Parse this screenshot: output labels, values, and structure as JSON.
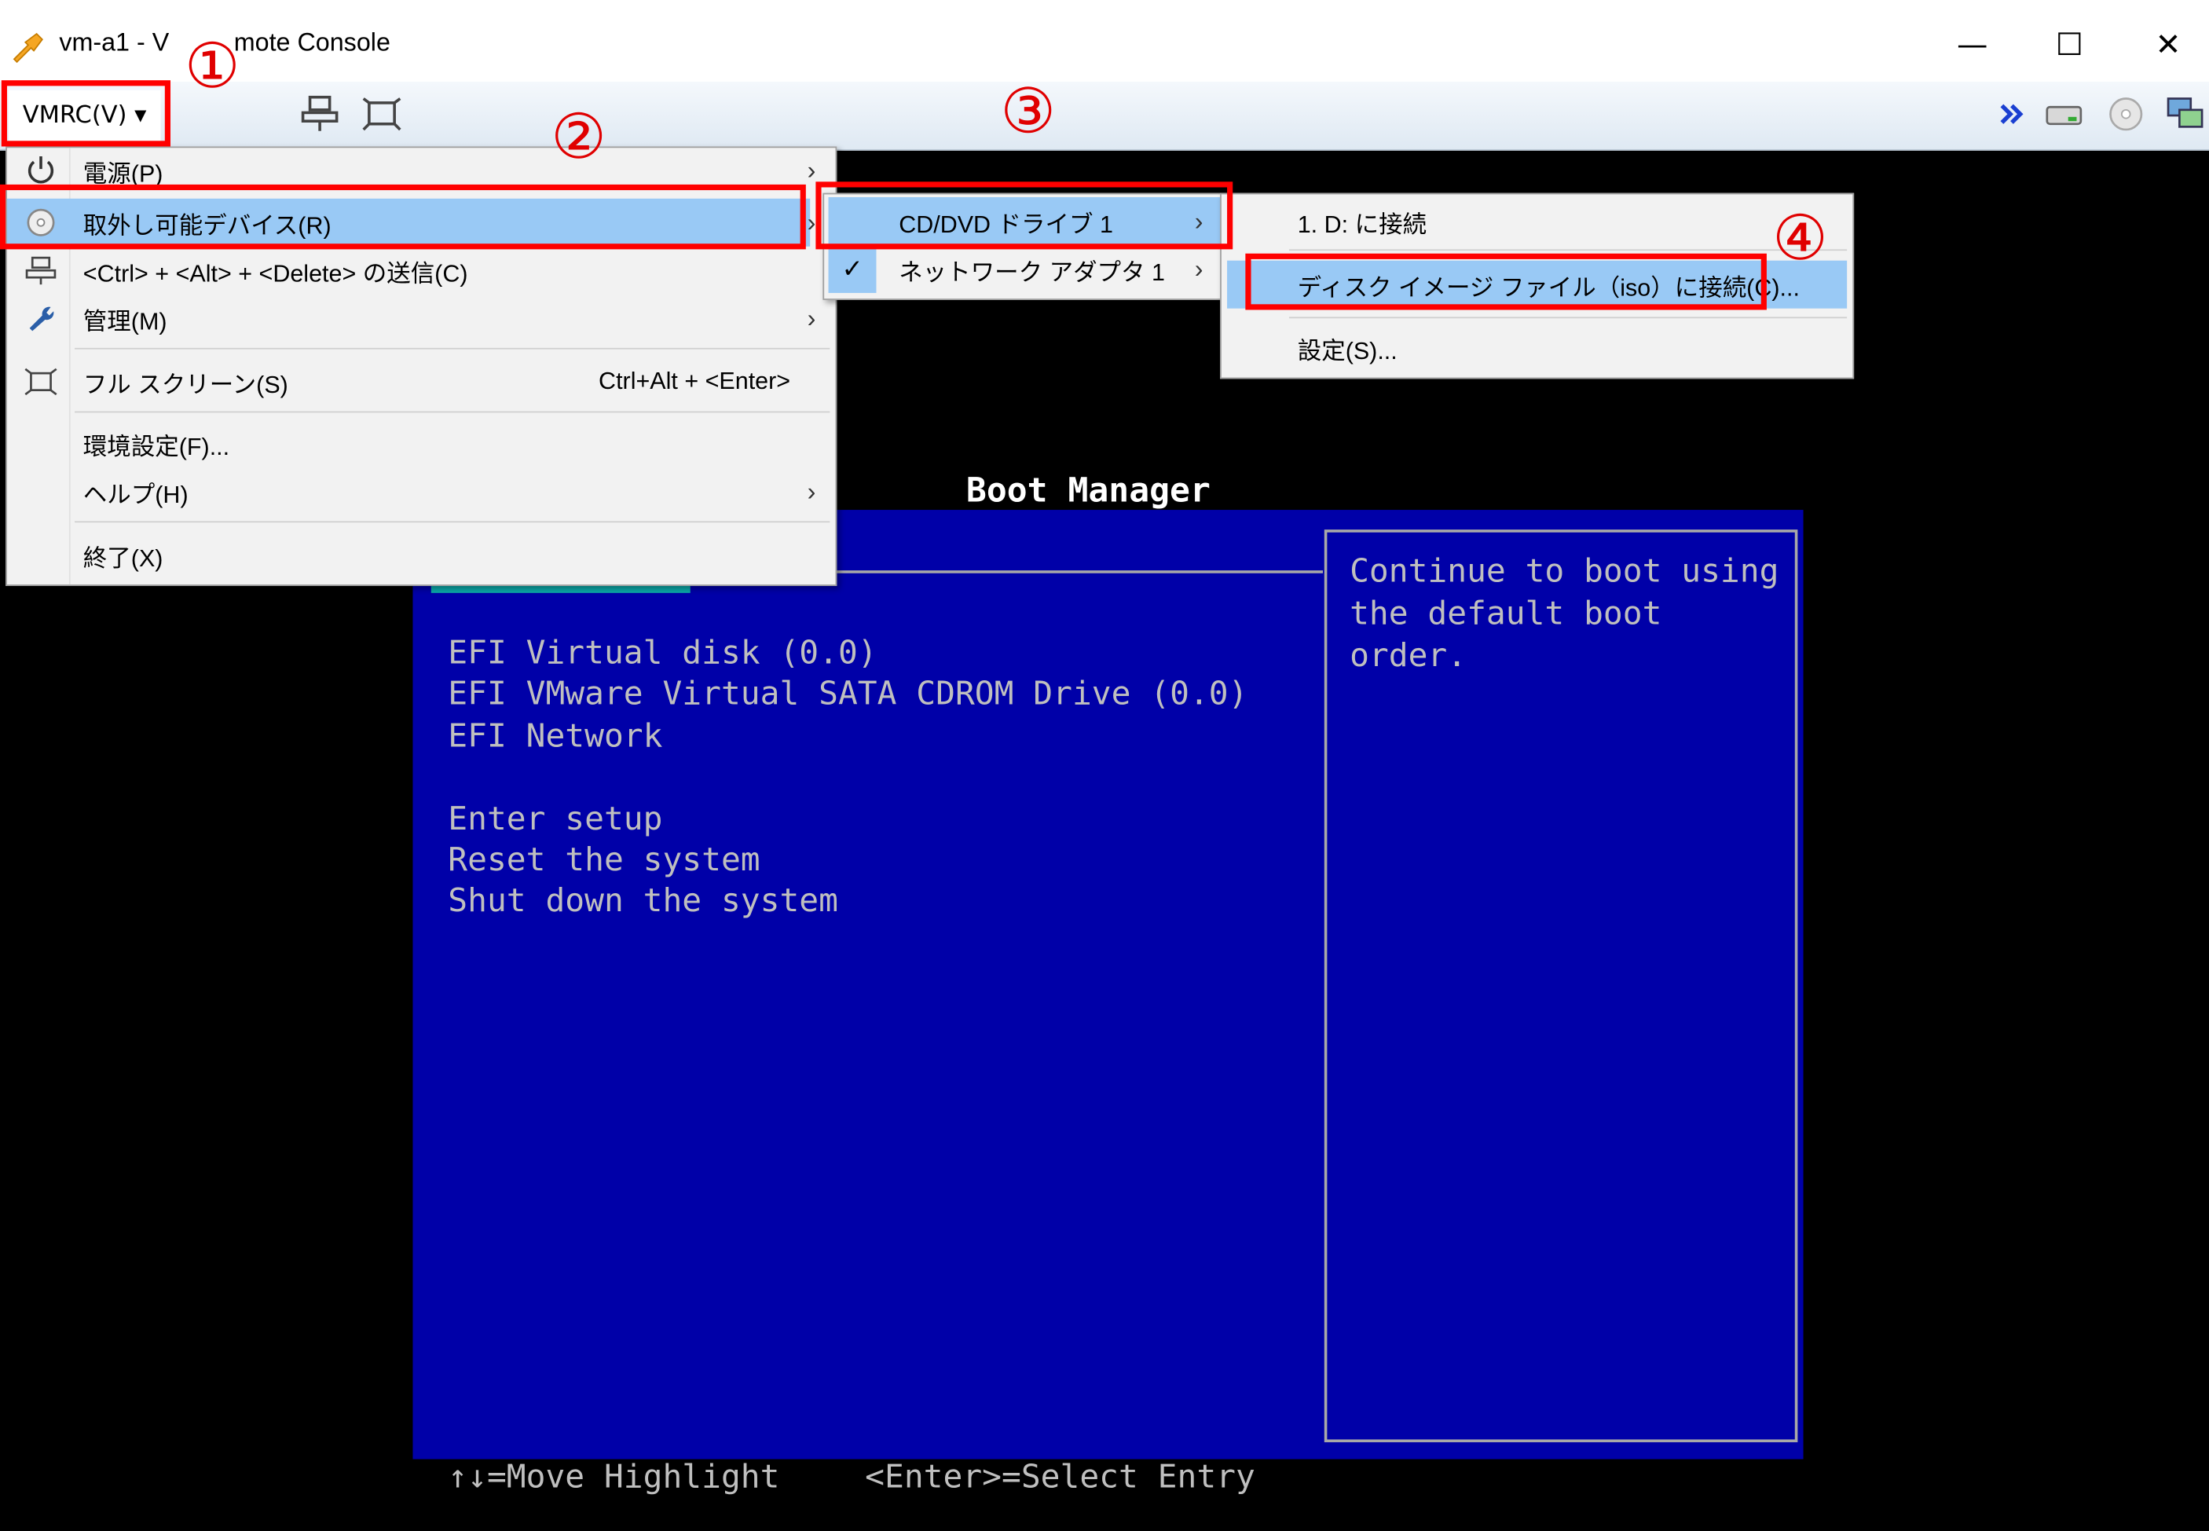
{
  "window": {
    "title": "vm-a1 - V",
    "title_suffix": "mote Console",
    "minimize_label": "—",
    "maximize_label": "☐",
    "close_label": "✕"
  },
  "toolbar": {
    "vmrc_label": "VMRC(V) ▾",
    "icons": [
      "ctrl-alt-del-icon",
      "fullscreen-icon",
      "double-chevron-icon",
      "drive-icon",
      "cd-icon",
      "network-icon"
    ]
  },
  "vmrc_menu": {
    "items": [
      {
        "label": "電源(P)",
        "icon": "power-icon",
        "submenu": true
      },
      {
        "label": "取外し可能デバイス(R)",
        "icon": "cd-icon",
        "submenu": true,
        "highlighted": true
      },
      {
        "label": "<Ctrl> + <Alt> + <Delete> の送信(C)",
        "icon": "ctrl-alt-del-icon"
      },
      {
        "label": "管理(M)",
        "icon": "wrench-icon",
        "submenu": true
      },
      {
        "label": "フル スクリーン(S)",
        "icon": "fullscreen-icon",
        "shortcut": "Ctrl+Alt + <Enter>"
      },
      {
        "label": "環境設定(F)..."
      },
      {
        "label": "ヘルプ(H)",
        "submenu": true
      },
      {
        "label": "終了(X)"
      }
    ]
  },
  "device_menu": {
    "items": [
      {
        "label": "CD/DVD ドライブ 1",
        "submenu": true,
        "highlighted": true
      },
      {
        "label": "ネットワーク アダプタ 1",
        "submenu": true,
        "checked": true
      }
    ]
  },
  "cd_menu": {
    "items": [
      {
        "label": "1. D: に接続"
      },
      {
        "label": "ディスク イメージ ファイル（iso）に接続(C)...",
        "highlighted": true
      },
      {
        "label": "設定(S)..."
      }
    ]
  },
  "annotations": [
    "①",
    "②",
    "③",
    "④"
  ],
  "boot": {
    "title": "Boot Manager",
    "help": "Continue to boot using\nthe default boot order.",
    "entries": [
      "EFI Virtual disk (0.0)",
      "EFI VMware Virtual SATA CDROM Drive (0.0)",
      "EFI Network",
      "Enter setup",
      "Reset the system",
      "Shut down the system"
    ],
    "footer_left": "↑↓=Move Highlight",
    "footer_right": "<Enter>=Select Entry"
  },
  "colors": {
    "boot_bg": "#0000a8",
    "menu_highlight": "#99c9f5",
    "annotation": "#ff0000"
  }
}
